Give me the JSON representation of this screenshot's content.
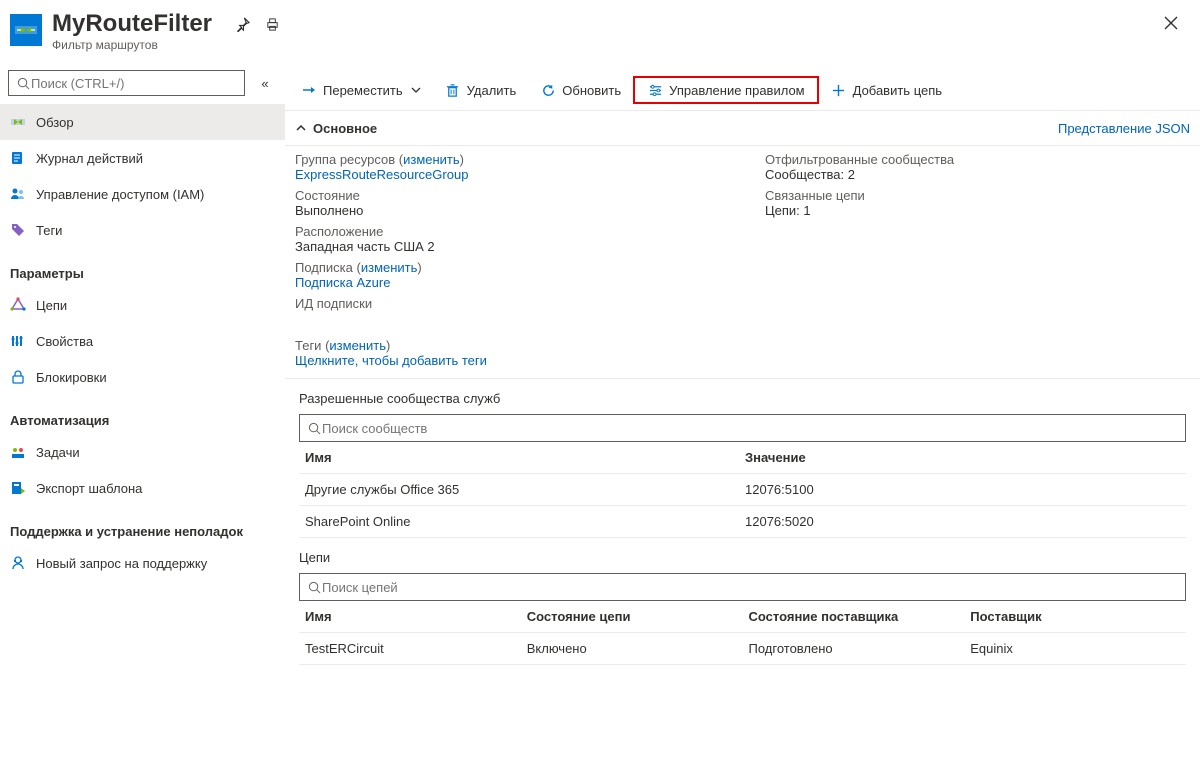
{
  "header": {
    "title": "MyRouteFilter",
    "subtitle": "Фильтр маршрутов"
  },
  "search": {
    "placeholder": "Поиск (CTRL+/)"
  },
  "sidebar": {
    "items_top": [
      {
        "label": "Обзор"
      },
      {
        "label": "Журнал действий"
      },
      {
        "label": "Управление доступом (IAM)"
      },
      {
        "label": "Теги"
      }
    ],
    "section_settings": "Параметры",
    "items_settings": [
      {
        "label": "Цепи"
      },
      {
        "label": "Свойства"
      },
      {
        "label": "Блокировки"
      }
    ],
    "section_automation": "Автоматизация",
    "items_automation": [
      {
        "label": "Задачи"
      },
      {
        "label": "Экспорт шаблона"
      }
    ],
    "section_support": "Поддержка и устранение неполадок",
    "items_support": [
      {
        "label": "Новый запрос на поддержку"
      }
    ]
  },
  "toolbar": {
    "move": "Переместить",
    "delete": "Удалить",
    "refresh": "Обновить",
    "manage_rule": "Управление правилом",
    "add_circuit": "Добавить цепь"
  },
  "essentials": {
    "header": "Основное",
    "json_view": "Представление JSON",
    "rg_label": "Группа ресурсов",
    "change": "изменить",
    "rg_value": "ExpressRouteResourceGroup",
    "state_label": "Состояние",
    "state_value": "Выполнено",
    "location_label": "Расположение",
    "location_value": "Западная часть США 2",
    "sub_label": "Подписка",
    "sub_value": "Подписка Azure",
    "subid_label": "ИД подписки",
    "filtered_label": "Отфильтрованные сообщества",
    "filtered_value": "Сообщества: 2",
    "circuits_label": "Связанные цепи",
    "circuits_value": "Цепи: 1",
    "tags_label": "Теги",
    "tags_value": "Щелкните, чтобы добавить теги"
  },
  "communities": {
    "title": "Разрешенные сообщества служб",
    "search_placeholder": "Поиск сообществ",
    "col_name": "Имя",
    "col_value": "Значение",
    "rows": [
      {
        "name": "Другие службы Office 365",
        "value": "12076:5100"
      },
      {
        "name": "SharePoint Online",
        "value": "12076:5020"
      }
    ]
  },
  "circuits": {
    "title": "Цепи",
    "search_placeholder": "Поиск цепей",
    "col_name": "Имя",
    "col_cstate": "Состояние цепи",
    "col_pstate": "Состояние поставщика",
    "col_provider": "Поставщик",
    "rows": [
      {
        "name": "TestERCircuit",
        "cstate": "Включено",
        "pstate": "Подготовлено",
        "provider": "Equinix"
      }
    ]
  }
}
